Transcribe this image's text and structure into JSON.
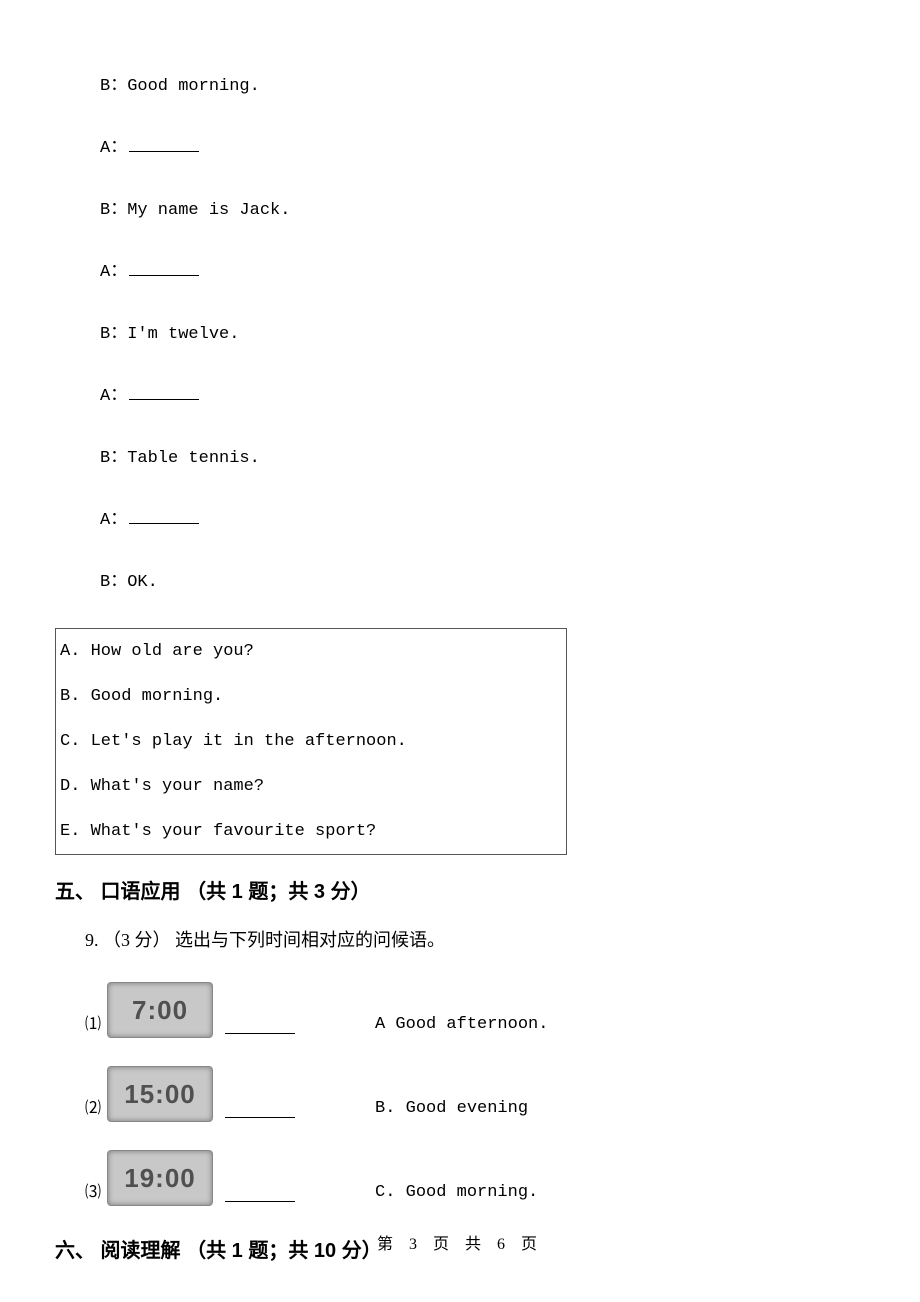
{
  "dialogue": {
    "line1": "B：Good morning.",
    "line2a": "A：",
    "line3": "B：My name is Jack.",
    "line4a": "A：",
    "line5": "B：I'm twelve.",
    "line6a": "A：",
    "line7": "B：Table tennis.",
    "line8a": "A：",
    "line9": "B：OK."
  },
  "options": {
    "a": "A. How old are you?",
    "b": "B. Good morning.",
    "c": "C. Let's play it in the afternoon.",
    "d": "D. What's your name?",
    "e": "E. What's your favourite sport?"
  },
  "section5": {
    "heading": "五、 口语应用 （共 1 题；共 3 分）",
    "q9stem": "9.  （3 分） 选出与下列时间相对应的问候语。",
    "rows": [
      {
        "idx": "⑴",
        "time": "7:00",
        "ans": "A Good afternoon."
      },
      {
        "idx": "⑵",
        "time": "15:00",
        "ans": "B. Good evening"
      },
      {
        "idx": "⑶",
        "time": "19:00",
        "ans": "C. Good morning."
      }
    ]
  },
  "section6": {
    "heading": "六、 阅读理解 （共 1 题；共 10 分）"
  },
  "footer": "第 3 页 共 6 页"
}
